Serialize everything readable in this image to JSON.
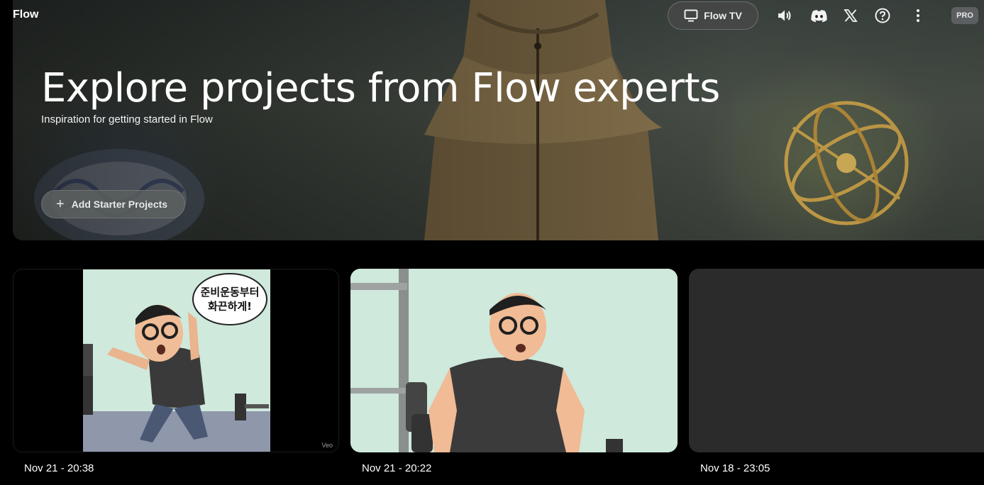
{
  "app": {
    "brand": "Flow"
  },
  "topbar": {
    "flow_tv_label": "Flow TV",
    "icons": [
      "tv-icon",
      "volume-icon",
      "discord-icon",
      "x-logo-icon",
      "help-icon",
      "more-vert-icon"
    ],
    "plan_badge": "PRO"
  },
  "hero": {
    "title": "Explore projects from Flow experts",
    "subtitle": "Inspiration for getting started in Flow",
    "add_button_label": "Add Starter Projects"
  },
  "projects": [
    {
      "date": "Nov 21 - 20:38",
      "speech_bubble": "준비운동부터\n화끈하게!",
      "watermark": "Veo"
    },
    {
      "date": "Nov 21 - 20:22"
    },
    {
      "date": "Nov 18 - 23:05"
    }
  ],
  "colors": {
    "background": "#000000",
    "button_bg": "#5a5f5f",
    "card_empty": "#2b2b2b",
    "comic_bg": "#cfe9dc"
  }
}
